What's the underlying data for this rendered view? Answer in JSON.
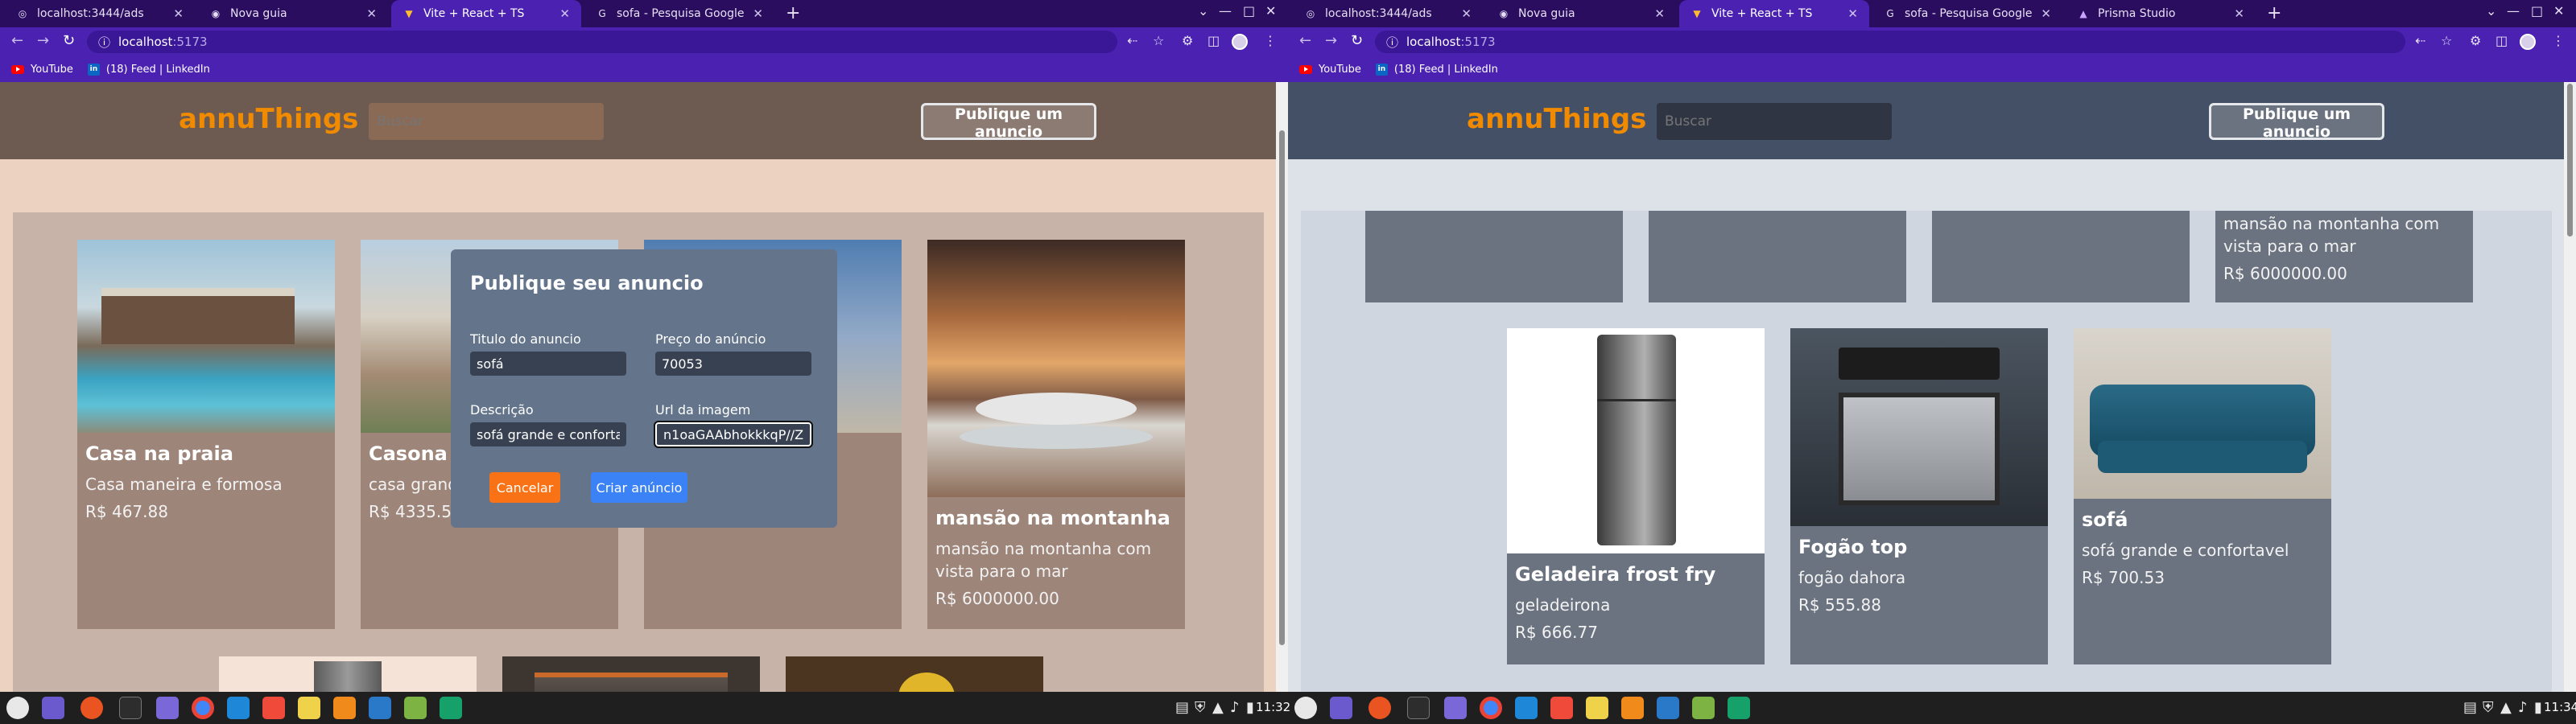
{
  "left_window": {
    "tabs": [
      {
        "title": "localhost:3444/ads"
      },
      {
        "title": "Nova guia"
      },
      {
        "title": "Vite + React + TS"
      },
      {
        "title": "sofa - Pesquisa Google"
      }
    ],
    "url": {
      "host": "localhost",
      "port": ":5173"
    },
    "bookmarks": [
      {
        "label": "YouTube"
      },
      {
        "label": "(18) Feed | LinkedIn"
      }
    ],
    "app": {
      "logo": "annuThings",
      "search_placeholder": "Buscar",
      "publish_label": "Publique um anuncio",
      "cards": [
        {
          "name": "Casa na praia",
          "desc": "Casa maneira e formosa",
          "price": "R$ 467.88"
        },
        {
          "name": "Casona",
          "desc": "casa grande",
          "price": "R$ 4335.55"
        },
        {
          "name": "",
          "desc": "",
          "price": ""
        },
        {
          "name": "mansão na montanha",
          "desc": "mansão na montanha com vista para o mar",
          "price": "R$ 6000000.00"
        }
      ],
      "modal": {
        "title": "Publique seu anuncio",
        "title_label": "Titulo do anuncio",
        "title_value": "sofá",
        "price_label": "Preço do anúncio",
        "price_value": "70053",
        "desc_label": "Descrição",
        "desc_value": "sofá grande e confortavel",
        "url_label": "Url da imagem",
        "url_value": "n1oaGAAbhokkkqP//Z",
        "cancel_label": "Cancelar",
        "create_label": "Criar anúncio"
      }
    }
  },
  "right_window": {
    "tabs": [
      {
        "title": "localhost:3444/ads"
      },
      {
        "title": "Nova guia"
      },
      {
        "title": "Vite + React + TS"
      },
      {
        "title": "sofa - Pesquisa Google"
      },
      {
        "title": "Prisma Studio"
      }
    ],
    "url": {
      "host": "localhost",
      "port": ":5173"
    },
    "bookmarks": [
      {
        "label": "YouTube"
      },
      {
        "label": "(18) Feed | LinkedIn"
      }
    ],
    "app": {
      "logo": "annuThings",
      "search_placeholder": "Buscar",
      "publish_label": "Publique um anuncio",
      "top_card": {
        "desc": "mansão na montanha com vista para o mar",
        "price": "R$ 6000000.00"
      },
      "cards": [
        {
          "name": "Geladeira frost fry",
          "desc": "geladeirona",
          "price": "R$ 666.77"
        },
        {
          "name": "Fogão top",
          "desc": "fogão dahora",
          "price": "R$ 555.88"
        },
        {
          "name": "sofá",
          "desc": "sofá grande e confortavel",
          "price": "R$ 700.53"
        }
      ]
    }
  },
  "taskbar": {
    "clock_left": "11:32",
    "clock_right": "11:34"
  },
  "colors": {
    "chrome_tabbar": "#2a0d5e",
    "chrome_toolbar": "#4a21b0",
    "left_header": "#6d5a50",
    "left_page": "#ecd2c0",
    "left_panel": "#c7b3a8",
    "left_card": "#9e857a",
    "right_header": "#445066",
    "right_page": "#dde2e9",
    "right_panel": "#cfd6e0",
    "right_card": "#6b7280",
    "logo_orange": "#f08a00"
  }
}
